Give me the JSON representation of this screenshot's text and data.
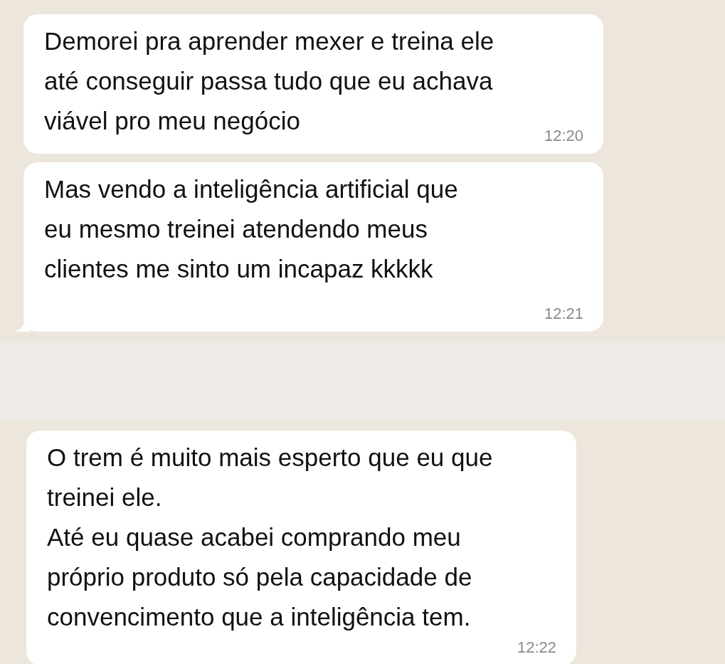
{
  "panels": [
    {
      "messages": [
        {
          "text": "Demorei pra aprender mexer e treina ele\naté conseguir passa tudo que eu achava\nviável pro meu negócio",
          "time": "12:20",
          "tail": false
        },
        {
          "text": "Mas vendo a inteligência artificial que\neu mesmo treinei atendendo meus\nclientes me sinto um incapaz kkkkk",
          "time": "12:21",
          "tail": true
        }
      ]
    },
    {
      "messages": [
        {
          "text": "O trem é muito mais esperto que eu que\ntreinei ele.\nAté eu quase acabei comprando meu\npróprio produto só pela capacidade de\nconvencimento que a inteligência tem.",
          "time": "12:22",
          "tail": false
        }
      ]
    }
  ]
}
